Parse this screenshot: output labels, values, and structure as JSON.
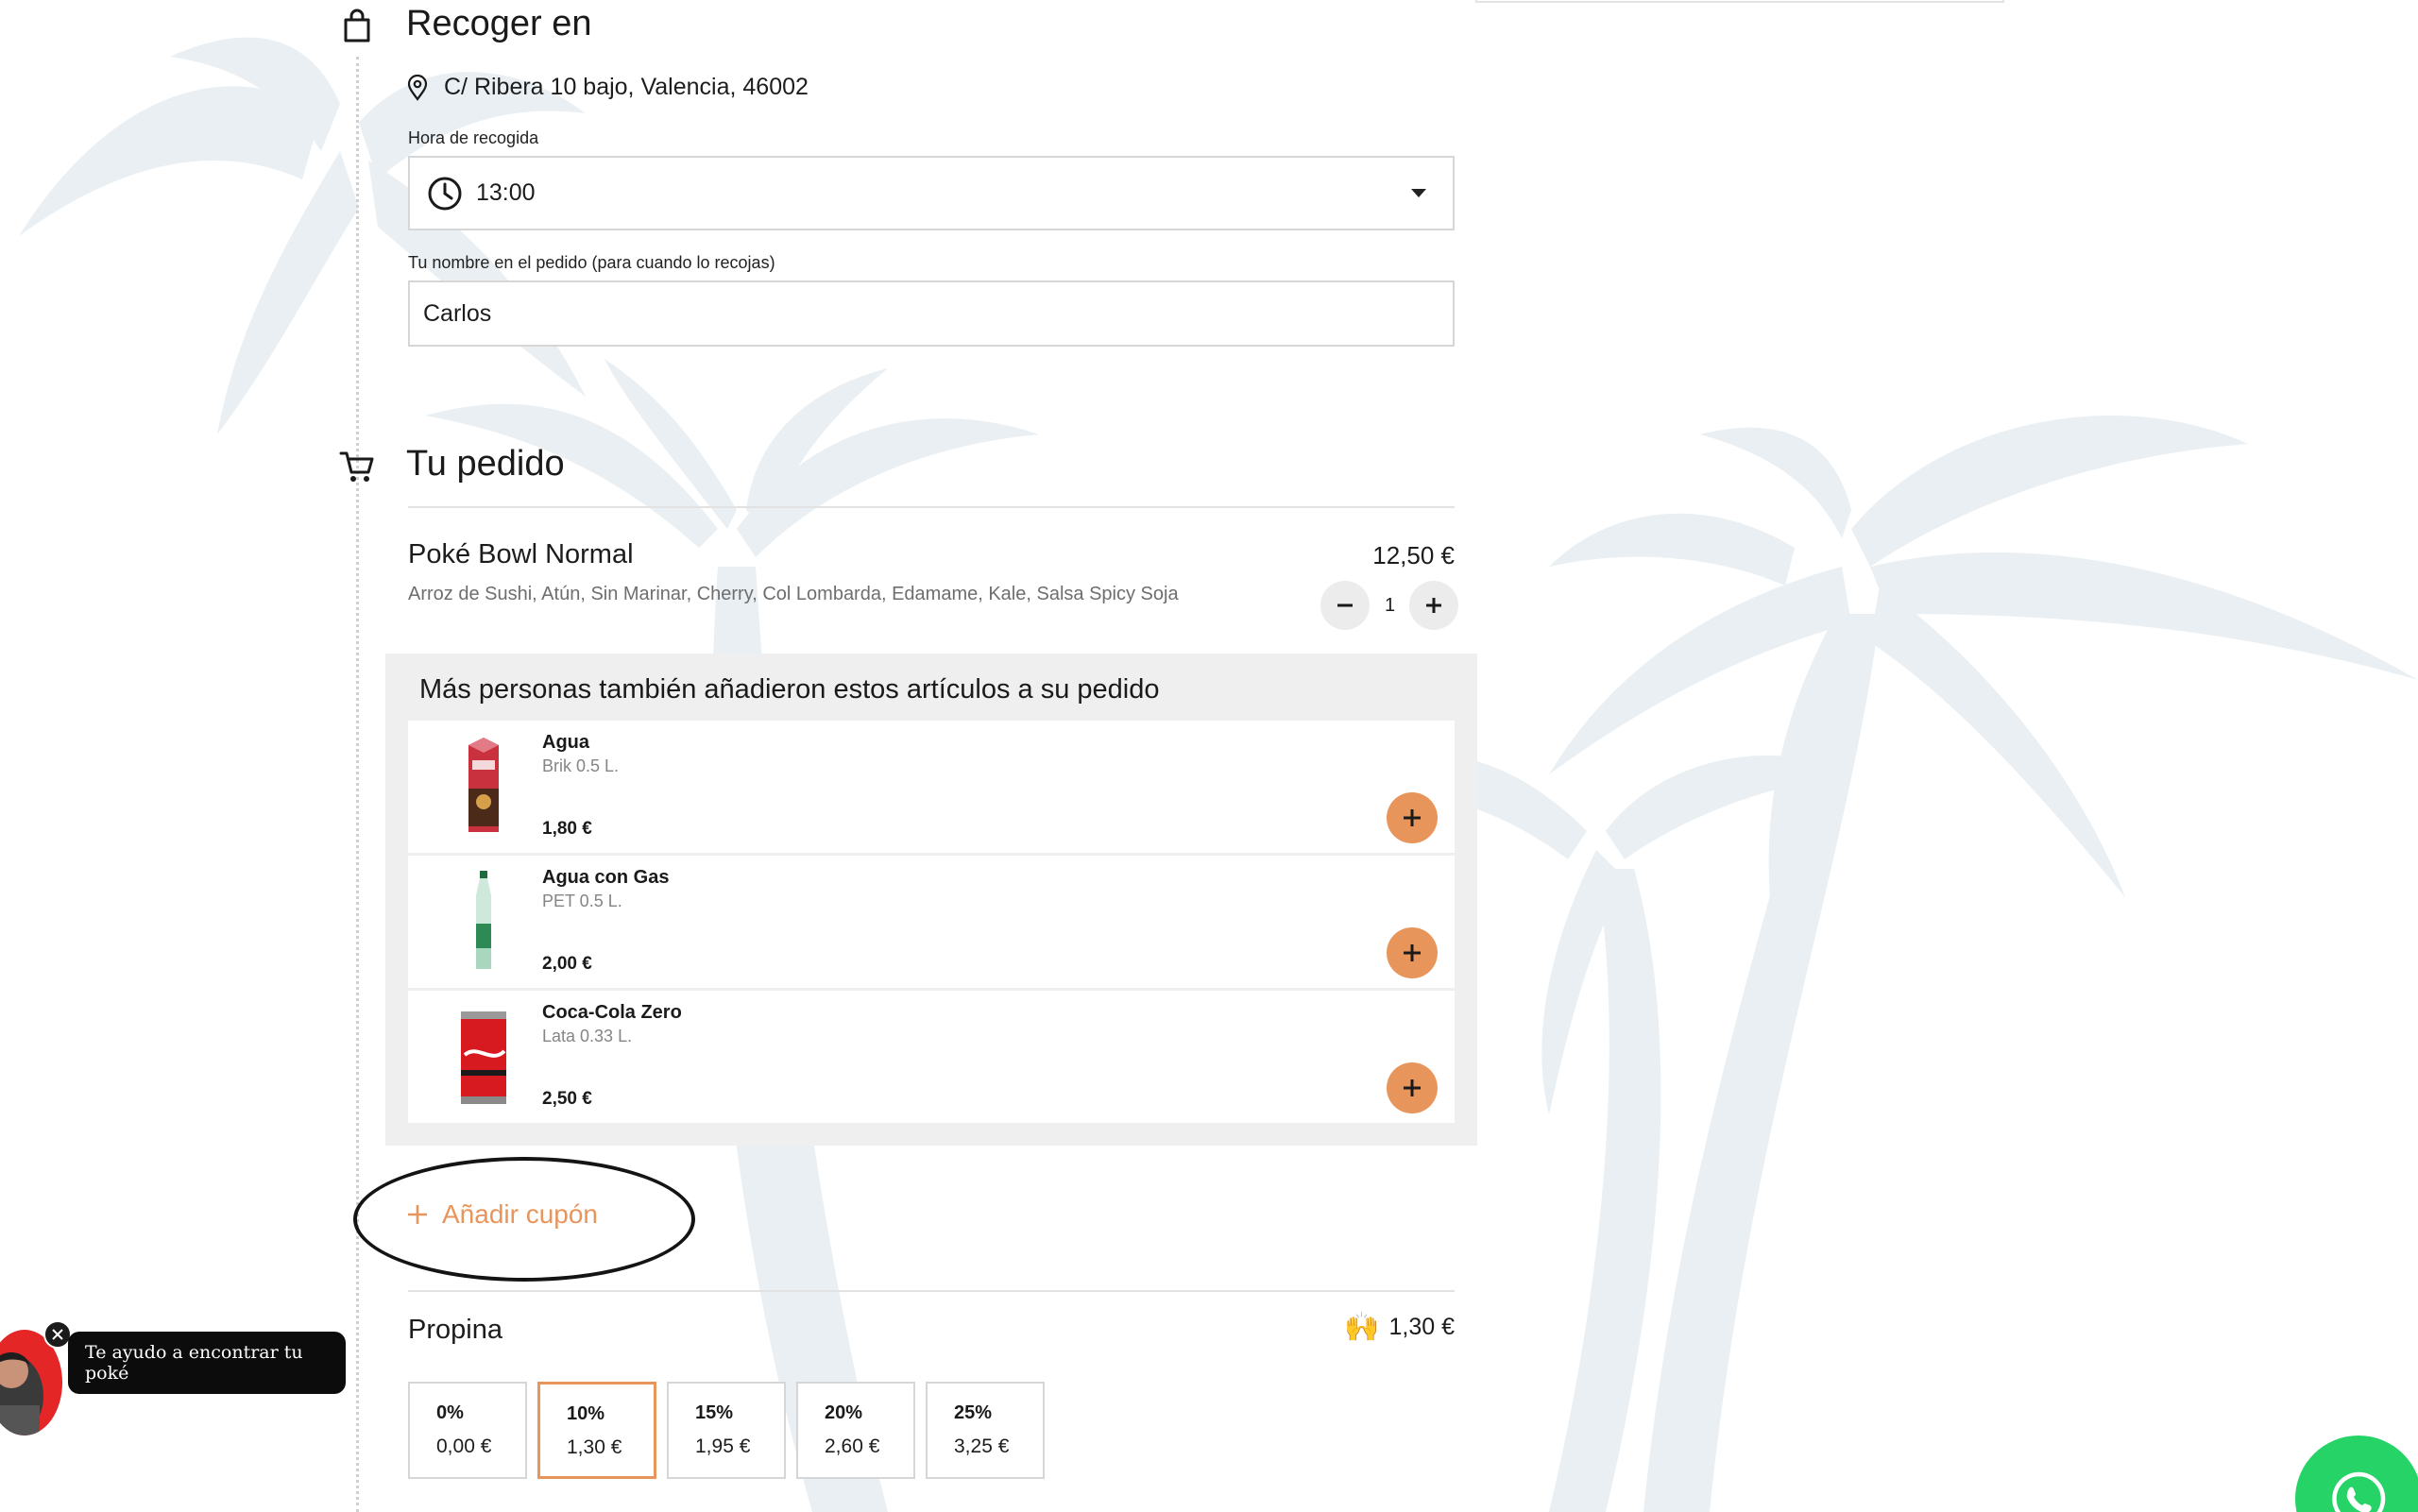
{
  "pickup": {
    "title": "Recoger en",
    "address": "C/ Ribera 10 bajo, Valencia, 46002",
    "time_label": "Hora de recogida",
    "time_value": "13:00",
    "name_label": "Tu nombre en el pedido (para cuando lo recojas)",
    "name_value": "Carlos"
  },
  "order": {
    "title": "Tu pedido",
    "item": {
      "name": "Poké Bowl Normal",
      "price": "12,50 €",
      "description": "Arroz de Sushi, Atún, Sin Marinar, Cherry, Col Lombarda, Edamame, Kale, Salsa Spicy Soja",
      "quantity": "1"
    }
  },
  "suggestions": {
    "title": "Más personas también añadieron estos artículos a su pedido",
    "items": [
      {
        "name": "Agua",
        "sub": "Brik 0.5 L.",
        "price": "1,80 €"
      },
      {
        "name": "Agua con Gas",
        "sub": "PET 0.5 L.",
        "price": "2,00 €"
      },
      {
        "name": "Coca-Cola Zero",
        "sub": "Lata 0.33 L.",
        "price": "2,50 €"
      }
    ]
  },
  "coupon": {
    "label": "Añadir cupón"
  },
  "tip": {
    "title": "Propina",
    "emoji": "🙌",
    "total": "1,30 €",
    "options": [
      {
        "pct": "0%",
        "amount": "0,00 €"
      },
      {
        "pct": "10%",
        "amount": "1,30 €",
        "selected": true
      },
      {
        "pct": "15%",
        "amount": "1,95 €"
      },
      {
        "pct": "20%",
        "amount": "2,60 €"
      },
      {
        "pct": "25%",
        "amount": "3,25 €"
      }
    ]
  },
  "chat": {
    "message": "Te ayudo a encontrar tu poké"
  },
  "colors": {
    "accent": "#e8955c",
    "whatsapp": "#25d366",
    "palm": "#e9eff2"
  }
}
